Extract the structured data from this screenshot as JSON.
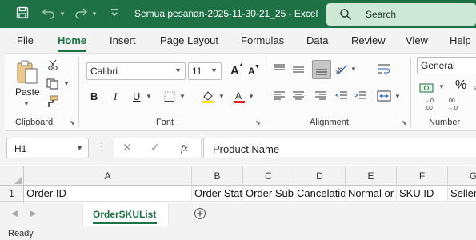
{
  "titlebar": {
    "title": "Semua pesanan-2025-11-30-21_25  -  Excel",
    "search_label": "Search"
  },
  "tabs": [
    "File",
    "Home",
    "Insert",
    "Page Layout",
    "Formulas",
    "Data",
    "Review",
    "View",
    "Help"
  ],
  "active_tab": "Home",
  "ribbon": {
    "clipboard": {
      "label": "Clipboard",
      "paste_label": "Paste"
    },
    "font": {
      "label": "Font",
      "font_name": "Calibri",
      "font_size": "11",
      "bold": "B",
      "italic": "I",
      "underline": "U",
      "grow": "A",
      "shrink": "A"
    },
    "alignment": {
      "label": "Alignment"
    },
    "number": {
      "label": "Number",
      "format": "General",
      "percent": "%"
    }
  },
  "formula_bar": {
    "name_box": "H1",
    "fx": "fx",
    "value": "Product Name"
  },
  "grid": {
    "columns": [
      "A",
      "B",
      "C",
      "D",
      "E",
      "F",
      "G"
    ],
    "rows": [
      {
        "row": "1",
        "cells": [
          "Order ID",
          "Order Stat",
          "Order Sub",
          "Cancelatio",
          "Normal or",
          "SKU ID",
          "Seller"
        ]
      }
    ]
  },
  "sheet_tab": "OrderSKUList",
  "status": "Ready",
  "colors": {
    "brand": "#1e7145",
    "search_bg": "#cfe7d6"
  }
}
